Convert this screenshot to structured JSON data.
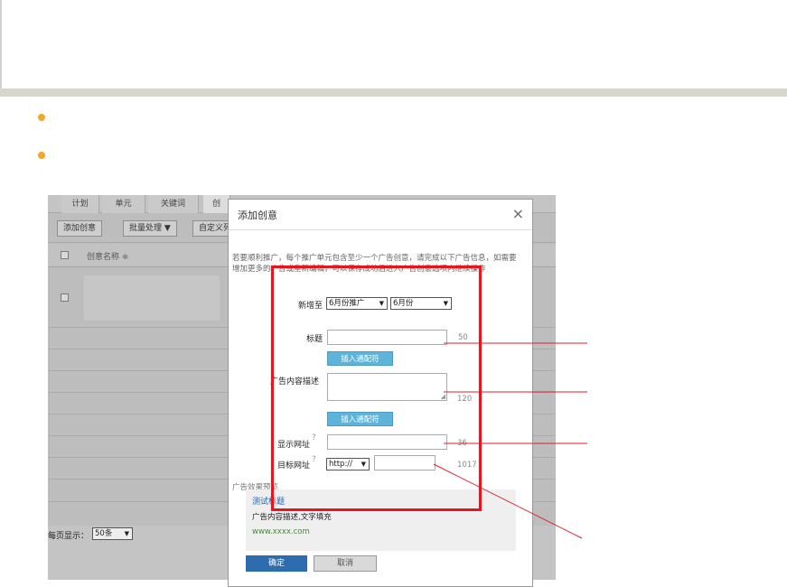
{
  "app": {
    "tabs": [
      "计划",
      "单元",
      "关键词",
      "创"
    ],
    "toolbar": {
      "add_label": "添加创意",
      "batch_label": "批量处理 ▼",
      "custom_label": "自定义列"
    },
    "table_header": {
      "name_col": "创意名称 ≑"
    },
    "pager": {
      "label": "每页显示：",
      "value": "50条"
    }
  },
  "dialog": {
    "title": "添加创意",
    "close_glyph": "×",
    "notice": "若要顺利推广，每个推广单元包含至少一个广告创意，请完成以下广告信息，如需要增加更多的广告或重新编辑，可以保存成功后进入广告创意选项内继续操作",
    "target": {
      "label": "新增至",
      "campaign": "6月份推广",
      "unit": "6月份"
    },
    "title_field": {
      "label": "标题",
      "value": "",
      "limit": "50"
    },
    "insert_wildcard_label": "插入通配符",
    "desc_field": {
      "label": "广告内容描述",
      "value": "",
      "limit": "120"
    },
    "display_url": {
      "label": "显示网址",
      "help": "?",
      "value": "",
      "limit": "36"
    },
    "target_url": {
      "label": "目标网址",
      "help": "?",
      "protocol": "http://",
      "value": "",
      "limit": "1017"
    },
    "preview": {
      "label": "广告效果预览",
      "title": "测试标题",
      "desc": "广告内容描述,文字填充",
      "url": "www.xxxx.com"
    },
    "ok_label": "确定",
    "cancel_label": "取消"
  },
  "colors": {
    "bullet": "#f5a623",
    "highlight": "#e8141e",
    "callout_line": "#d9212b",
    "primary_button": "#2e6cb0",
    "insert_button": "#5eb3d9",
    "preview_title": "#2463b5",
    "preview_url": "#4a8a3a"
  }
}
